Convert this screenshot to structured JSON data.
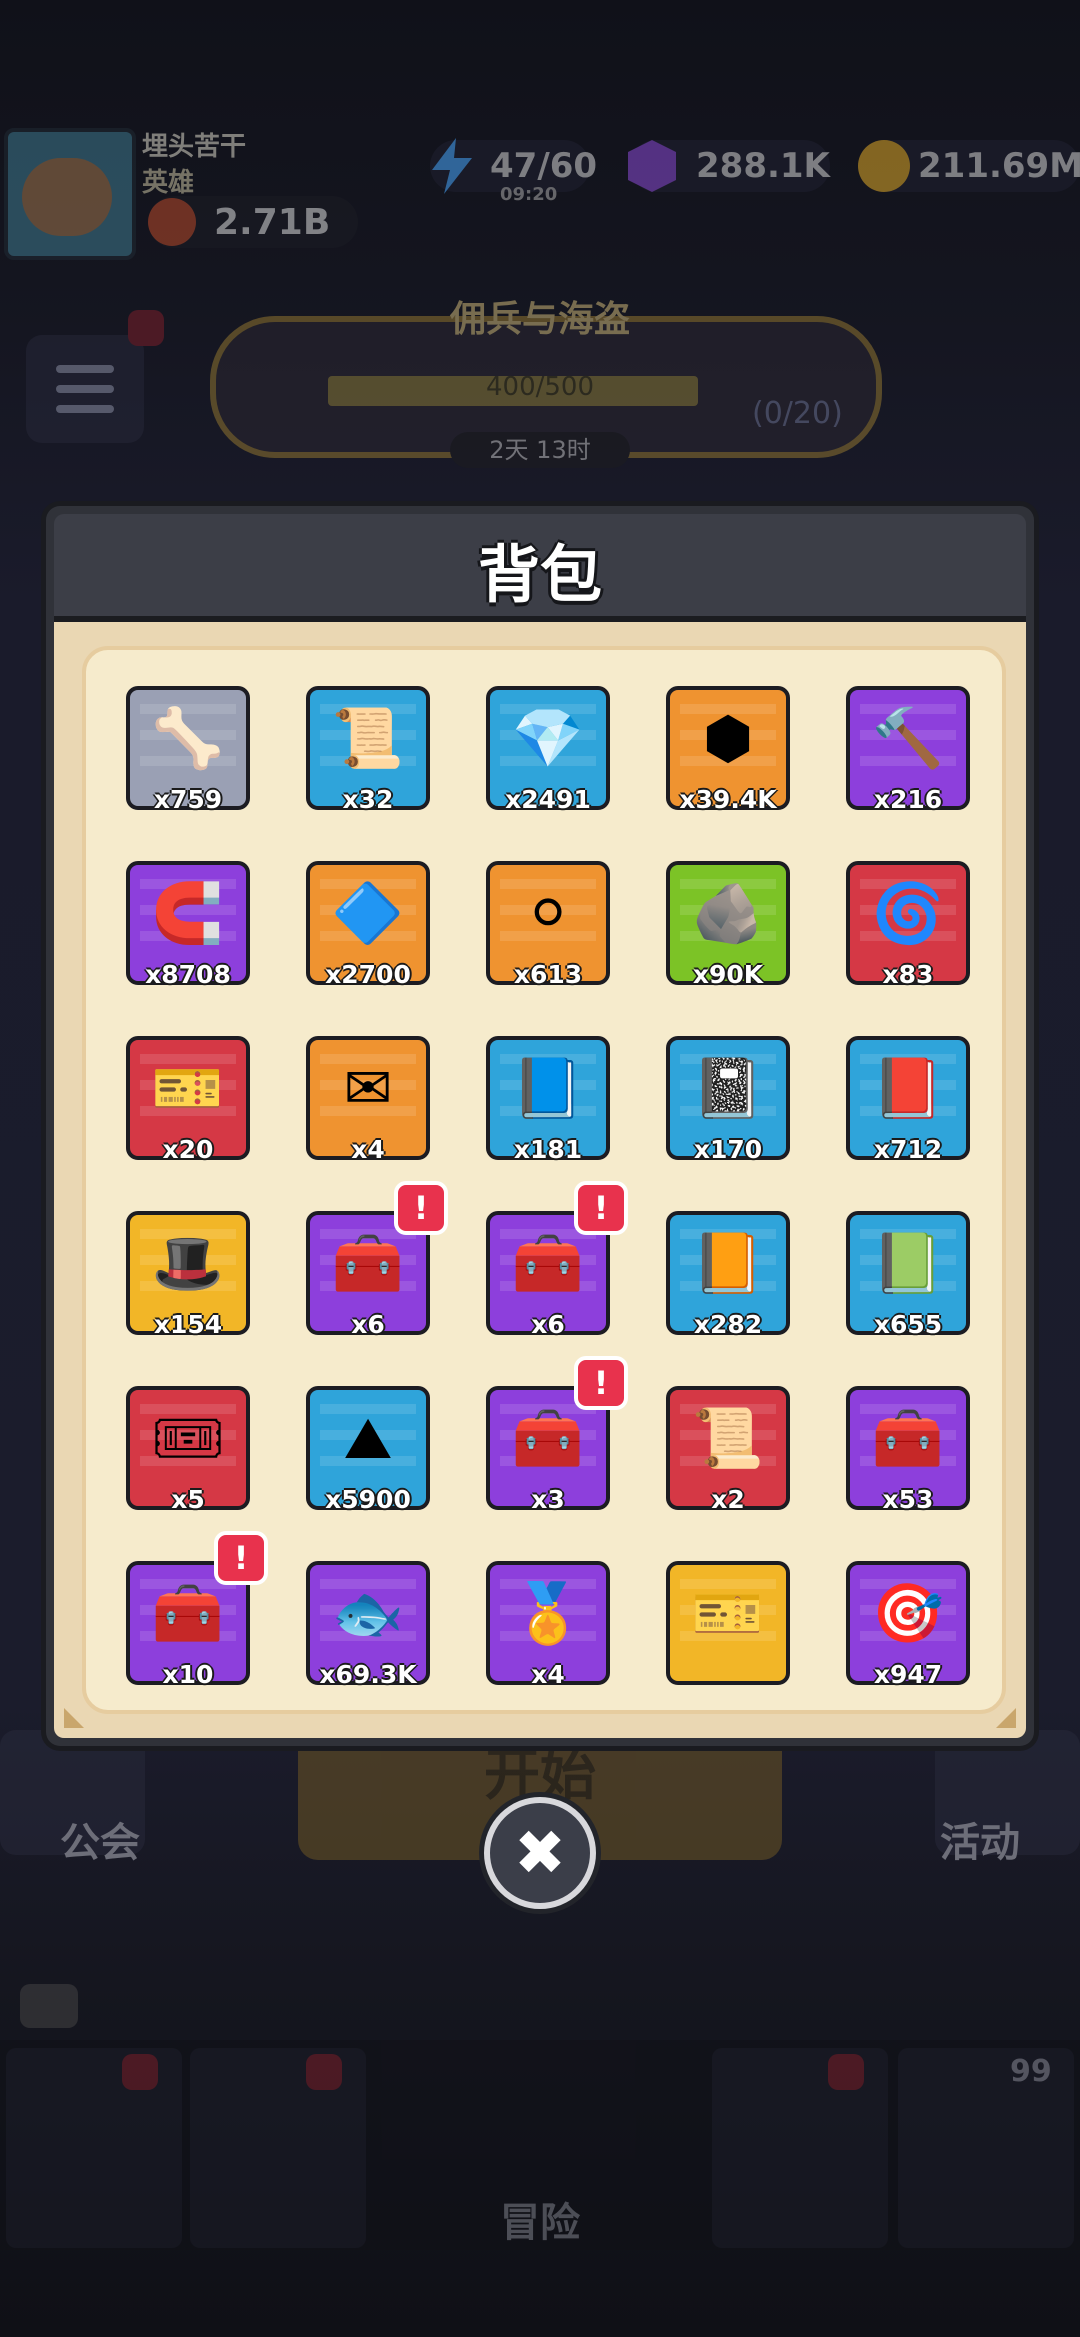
{
  "player": {
    "name": "埋头苦干",
    "title": "英雄",
    "power": "2.71B"
  },
  "resources": {
    "energy": "47/60",
    "energy_timer": "09:20",
    "gems": "288.1K",
    "gold": "211.69M"
  },
  "event": {
    "title": "佣兵与海盗",
    "progress": "400/500",
    "count": "(0/20)",
    "timer": "2天 13时"
  },
  "background": {
    "guild": "公会",
    "start": "开始",
    "activity": "活动",
    "adventure": "冒险",
    "nav_count": "99"
  },
  "modal": {
    "title": "背包",
    "close_label": "✖"
  },
  "items": [
    {
      "icon": "bone-icon",
      "glyph": "🦴",
      "count": "x759",
      "bg": "#9aa0b4",
      "alert": false
    },
    {
      "icon": "scroll-icon",
      "glyph": "📜",
      "count": "x32",
      "bg": "#2fa4da",
      "alert": false
    },
    {
      "icon": "crystal-icon",
      "glyph": "💎",
      "count": "x2491",
      "bg": "#2fa4da",
      "alert": false
    },
    {
      "icon": "hex-badge-icon",
      "glyph": "⬢",
      "count": "x39.4K",
      "bg": "#ef9330",
      "alert": false
    },
    {
      "icon": "hammer-icon",
      "glyph": "🔨",
      "count": "x216",
      "bg": "#8d3fdc",
      "alert": false
    },
    {
      "icon": "horseshoe-icon",
      "glyph": "🧲",
      "count": "x8708",
      "bg": "#8d3fdc",
      "alert": false
    },
    {
      "icon": "purple-gem-icon",
      "glyph": "🔷",
      "count": "x2700",
      "bg": "#ef9330",
      "alert": false
    },
    {
      "icon": "silver-coin-icon",
      "glyph": "⚪",
      "count": "x613",
      "bg": "#ef9330",
      "alert": false
    },
    {
      "icon": "rune-stone-icon",
      "glyph": "🪨",
      "count": "x90K",
      "bg": "#7cc326",
      "alert": false
    },
    {
      "icon": "blue-orb-icon",
      "glyph": "🌀",
      "count": "x83",
      "bg": "#d53845",
      "alert": false
    },
    {
      "icon": "blue-ticket-icon",
      "glyph": "🎫",
      "count": "x20",
      "bg": "#d53845",
      "alert": false
    },
    {
      "icon": "envelope-icon",
      "glyph": "✉",
      "count": "x4",
      "bg": "#ef9330",
      "alert": false
    },
    {
      "icon": "purple-book-icon",
      "glyph": "📘",
      "count": "x181",
      "bg": "#2fa4da",
      "alert": false
    },
    {
      "icon": "skull-book-icon",
      "glyph": "📓",
      "count": "x170",
      "bg": "#2fa4da",
      "alert": false
    },
    {
      "icon": "red-book-icon",
      "glyph": "📕",
      "count": "x712",
      "bg": "#2fa4da",
      "alert": false
    },
    {
      "icon": "witch-hat-icon",
      "glyph": "🎩",
      "count": "x154",
      "bg": "#f2b627",
      "alert": false
    },
    {
      "icon": "mystery-chest-icon",
      "glyph": "🧰",
      "count": "x6",
      "bg": "#8d3fdc",
      "alert": true
    },
    {
      "icon": "skull-chest-icon",
      "glyph": "🧰",
      "count": "x6",
      "bg": "#8d3fdc",
      "alert": true
    },
    {
      "icon": "orange-book-icon",
      "glyph": "📙",
      "count": "x282",
      "bg": "#2fa4da",
      "alert": false
    },
    {
      "icon": "leaf-book-icon",
      "glyph": "📗",
      "count": "x655",
      "bg": "#2fa4da",
      "alert": false
    },
    {
      "icon": "gold-ticket-icon",
      "glyph": "🎟",
      "count": "x5",
      "bg": "#d53845",
      "alert": false
    },
    {
      "icon": "gold-pile-icon",
      "glyph": "⛰",
      "count": "x5900",
      "bg": "#2fa4da",
      "alert": false
    },
    {
      "icon": "lion-chest-icon",
      "glyph": "🧰",
      "count": "x3",
      "bg": "#8d3fdc",
      "alert": true
    },
    {
      "icon": "recipe-scroll-icon",
      "glyph": "📜",
      "count": "x2",
      "bg": "#d53845",
      "alert": false
    },
    {
      "icon": "knight-chest-icon",
      "glyph": "🧰",
      "count": "x53",
      "bg": "#8d3fdc",
      "alert": false
    },
    {
      "icon": "purple-chest-icon",
      "glyph": "🧰",
      "count": "x10",
      "bg": "#8d3fdc",
      "alert": true
    },
    {
      "icon": "fish-coin-icon",
      "glyph": "🐟",
      "count": "x69.3K",
      "bg": "#8d3fdc",
      "alert": false
    },
    {
      "icon": "fish-medal-icon",
      "glyph": "🏅",
      "count": "x4",
      "bg": "#8d3fdc",
      "alert": false
    },
    {
      "icon": "coupon-icon",
      "glyph": "🎫",
      "count": "",
      "bg": "#f2b627",
      "alert": false
    },
    {
      "icon": "target-icon",
      "glyph": "🎯",
      "count": "x947",
      "bg": "#8d3fdc",
      "alert": false
    }
  ]
}
